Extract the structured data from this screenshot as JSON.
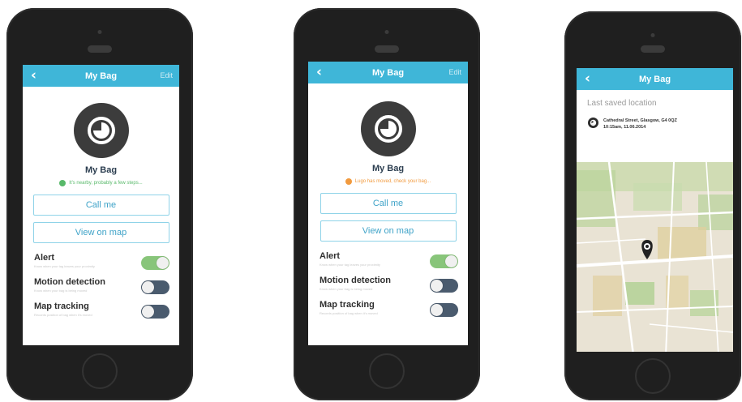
{
  "colors": {
    "navbar": "#3fb6d8",
    "status_green": "#58b96a",
    "status_orange": "#f19a3e",
    "toggle_on": "#88c57a",
    "toggle_off": "#4a5b6e"
  },
  "phone1": {
    "nav": {
      "back_icon": "chevron-left-icon",
      "title": "My Bag",
      "edit": "Edit"
    },
    "bag_name": "My Bag",
    "status_text": "It's nearby, probably a few steps...",
    "call_label": "Call me",
    "map_label": "View on map",
    "settings": [
      {
        "label": "Alert",
        "sub": "Know when your tag leaves your proximity",
        "state": "on"
      },
      {
        "label": "Motion detection",
        "sub": "Know when your bag is being moved",
        "state": "off"
      },
      {
        "label": "Map tracking",
        "sub": "Records position of bag when it's moved",
        "state": "off"
      }
    ]
  },
  "phone2": {
    "nav": {
      "back_icon": "chevron-left-icon",
      "title": "My Bag",
      "edit": "Edit"
    },
    "bag_name": "My Bag",
    "status_text": "Lugo has moved, check your bag...",
    "call_label": "Call me",
    "map_label": "View on map",
    "settings": [
      {
        "label": "Alert",
        "sub": "Know when your tag leaves your proximity",
        "state": "on"
      },
      {
        "label": "Motion detection",
        "sub": "Know when your bag is being moved",
        "state": "off"
      },
      {
        "label": "Map tracking",
        "sub": "Records position of bag when it's moved",
        "state": "off"
      }
    ]
  },
  "phone3": {
    "nav": {
      "back_icon": "chevron-left-icon",
      "title": "My Bag"
    },
    "location_title": "Last saved location",
    "address_line1": "Cathedral Street, Glasgow, G4 0QZ",
    "address_line2": "10:15am, 11.06.2014"
  }
}
